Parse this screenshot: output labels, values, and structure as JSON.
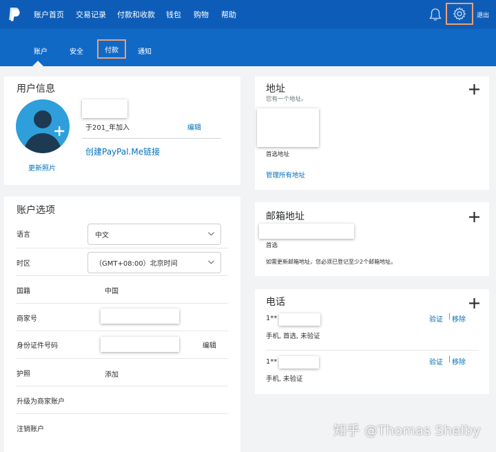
{
  "nav": {
    "items": [
      "账户首页",
      "交易记录",
      "付款和收款",
      "钱包",
      "购物",
      "帮助"
    ],
    "logout": "退出"
  },
  "subnav": {
    "account": "账户",
    "security": "安全",
    "payments": "付款",
    "notifications": "通知"
  },
  "user_info": {
    "title": "用户信息",
    "joined": "于201_年加入",
    "edit": "编辑",
    "paypalme": "创建PayPal.Me链接",
    "update_photo": "更新照片"
  },
  "address": {
    "title": "地址",
    "subtitle": "您有一个地址。",
    "primary": "首选地址",
    "manage": "管理所有地址"
  },
  "email": {
    "title": "邮箱地址",
    "primary": "首选",
    "note": "如需更新邮箱地址，您必须已登记至少2个邮箱地址。"
  },
  "phone": {
    "title": "电话",
    "items": [
      {
        "number": "1**",
        "desc": "手机, 首选, 未验证",
        "verify": "验证",
        "remove": "移除"
      },
      {
        "number": "1**",
        "desc": "手机, 未验证",
        "verify": "验证",
        "remove": "移除"
      }
    ]
  },
  "account_options": {
    "title": "账户选项",
    "language_label": "语言",
    "language_value": "中文",
    "timezone_label": "时区",
    "timezone_value": "（GMT+08:00）北京时间",
    "nationality_label": "国籍",
    "nationality_value": "中国",
    "merchant_label": "商家号",
    "id_label": "身份证件号码",
    "id_edit": "编辑",
    "passport_label": "护照",
    "passport_add": "添加",
    "upgrade": "升级为商家账户",
    "close": "注销账户"
  },
  "watermark": "知乎 @Thomas Shelby",
  "colors": {
    "nav_bg": "#0d5db8",
    "subnav_bg": "#1169c6",
    "link": "#0070ba",
    "highlight": "#f2a06e",
    "avatar": "#2e9fdb"
  }
}
